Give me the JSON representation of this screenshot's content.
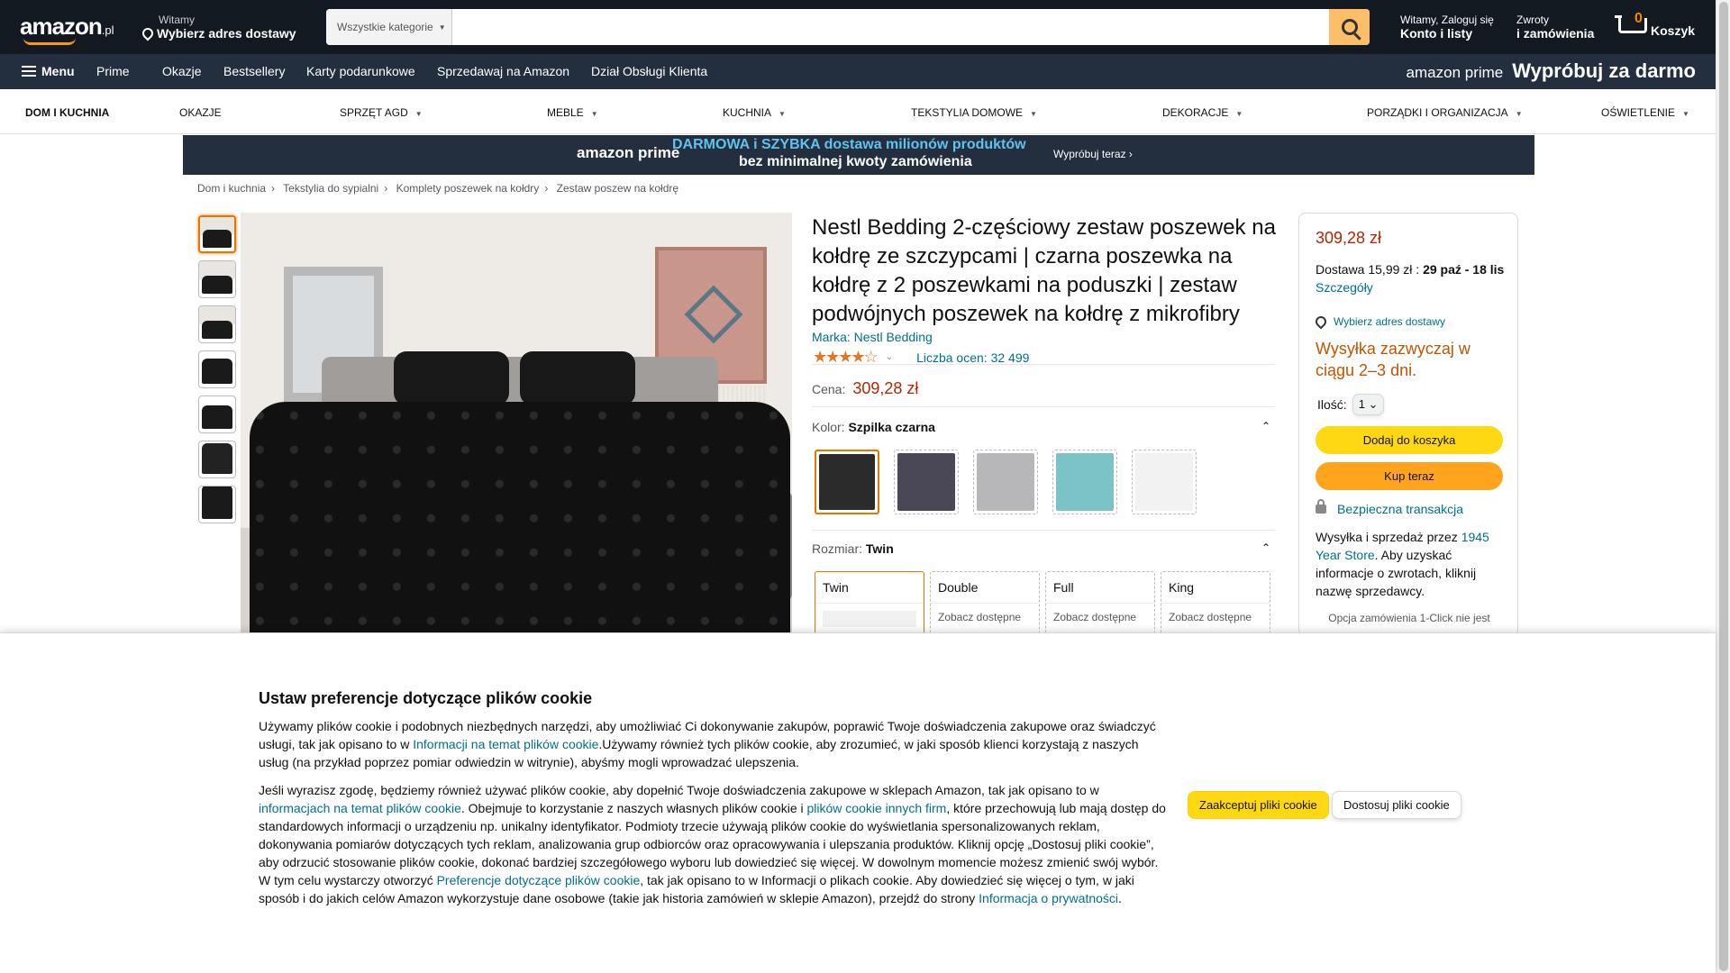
{
  "header": {
    "logo_text": "amazon",
    "logo_suffix": ".pl",
    "deliver_line1": "Witamy",
    "deliver_line2": "Wybierz adres dostawy",
    "search_category": "Wszystkie kategorie",
    "search_value": "",
    "account_line1": "Witamy, Zaloguj się",
    "account_line2": "Konto i listy",
    "orders_line1": "Zwroty",
    "orders_line2": "i zamówienia",
    "cart_count": "0",
    "cart_label": "Koszyk"
  },
  "subnav": {
    "menu": "Menu",
    "items": [
      "Prime",
      "Okazje",
      "Bestsellery",
      "Karty podarunkowe",
      "Sprzedawaj na Amazon",
      "Dział Obsługi Klienta"
    ],
    "prime_logo": "amazon prime",
    "prime_cta": "Wypróbuj za darmo"
  },
  "category_bar": {
    "items": [
      "DOM I KUCHNIA",
      "OKAZJE",
      "SPRZĘT AGD",
      "MEBLE",
      "KUCHNIA",
      "TEKSTYLIA DOMOWE",
      "DEKORACJE",
      "PORZĄDKI I ORGANIZACJA",
      "OŚWIETLENIE"
    ]
  },
  "banner": {
    "prime": "amazon prime",
    "line1": "DARMOWA i SZYBKA dostawa milionów produktów",
    "line2": "bez minimalnej kwoty zamówienia",
    "cta": "Wypróbuj teraz ›"
  },
  "breadcrumb": [
    "Dom i kuchnia",
    "Tekstylia do sypialni",
    "Komplety poszewek na kołdry",
    "Zestaw poszew na kołdrę"
  ],
  "product": {
    "title": "Nestl Bedding 2-częściowy zestaw poszewek na kołdrę ze szczypcami | czarna poszewka na kołdrę z 2 poszewkami na poduszki | zestaw podwójnych poszewek na kołdrę z mikrofibry",
    "brand": "Marka: Nestl Bedding",
    "stars": "★★★★☆",
    "rating_count": "Liczba ocen: 32 499",
    "price_label": "Cena:",
    "price": "309,28 zł",
    "color_label": "Kolor:",
    "color_value": "Szpilka czarna",
    "swatch_colors": [
      "#2b2b2b",
      "#4a4756",
      "#b7b7b9",
      "#7cc3c7",
      "#f2f2f2"
    ],
    "size_label": "Rozmiar:",
    "size_value": "Twin",
    "sizes": [
      {
        "name": "Twin",
        "sub": ""
      },
      {
        "name": "Double",
        "sub": "Zobacz dostępne"
      },
      {
        "name": "Full",
        "sub": "Zobacz dostępne"
      },
      {
        "name": "King",
        "sub": "Zobacz dostępne"
      }
    ]
  },
  "buybox": {
    "price": "309,28 zł",
    "delivery_prefix": "Dostawa 15,99 zł : ",
    "delivery_dates": "29 paź - 18 lis",
    "delivery_link": "Szczegóły",
    "address": "Wybierz adres dostawy",
    "stock": "Wysyłka zazwyczaj w ciągu 2–3 dni.",
    "qty_label": "Ilość:",
    "qty_value": "1",
    "add_to_cart": "Dodaj do koszyka",
    "buy_now": "Kup teraz",
    "secure": "Bezpieczna transakcja",
    "ship_prefix": "Wysyłka i sprzedaż przez ",
    "ship_seller": "1945 Year Store",
    "ship_suffix": ". Aby uzyskać informacje o zwrotach, kliknij nazwę sprzedawcy.",
    "one_click": "Opcja zamówienia 1-Click nie jest"
  },
  "cookie": {
    "title": "Ustaw preferencje dotyczące plików cookie",
    "p1_a": "Używamy plików cookie i podobnych niezbędnych narzędzi, aby umożliwiać Ci dokonywanie zakupów, poprawić Twoje doświadczenia zakupowe oraz świadczyć usługi, tak jak opisano to w ",
    "p1_link": "Informacji na temat plików cookie",
    "p1_b": ".Używamy również tych plików cookie, aby zrozumieć, w jaki sposób klienci korzystają z naszych usług (na przykład poprzez pomiar odwiedzin w witrynie), abyśmy mogli wprowadzać ulepszenia.",
    "p2_a": "Jeśli wyrazisz zgodę, będziemy również używać plików cookie, aby dopełnić Twoje doświadczenia zakupowe w sklepach Amazon, tak jak opisano to w ",
    "p2_link1": "informacjach na temat plików cookie",
    "p2_b": ". Obejmuje to korzystanie z naszych własnych plików cookie i ",
    "p2_link2": "plików cookie innych firm",
    "p2_c": ", które przechowują lub mają dostęp do standardowych informacji o urządzeniu np. unikalny identyfikator. Podmioty trzecie używają plików cookie do wyświetlania spersonalizowanych reklam, dokonywania pomiarów dotyczących tych reklam, analizowania grup odbiorców oraz opracowywania i ulepszania produktów. Kliknij opcję „Dostosuj pliki cookie”, aby odrzucić stosowanie plików cookie, dokonać bardziej szczegółowego wyboru lub dowiedzieć się więcej. W dowolnym momencie możesz zmienić swój wybór. W tym celu wystarczy otworzyć ",
    "p2_link3": "Preferencje dotyczące plików cookie",
    "p2_d": ", tak jak opisano to w Informacji o plikach cookie. Aby dowiedzieć się więcej o tym, w jaki sposób i do jakich celów Amazon wykorzystuje dane osobowe (takie jak historia zamówień w sklepie Amazon), przejdź do strony ",
    "p2_link4": "Informacja o prywatności",
    "p2_e": ".",
    "accept": "Zaakceptuj pliki cookie",
    "customize": "Dostosuj pliki cookie"
  }
}
